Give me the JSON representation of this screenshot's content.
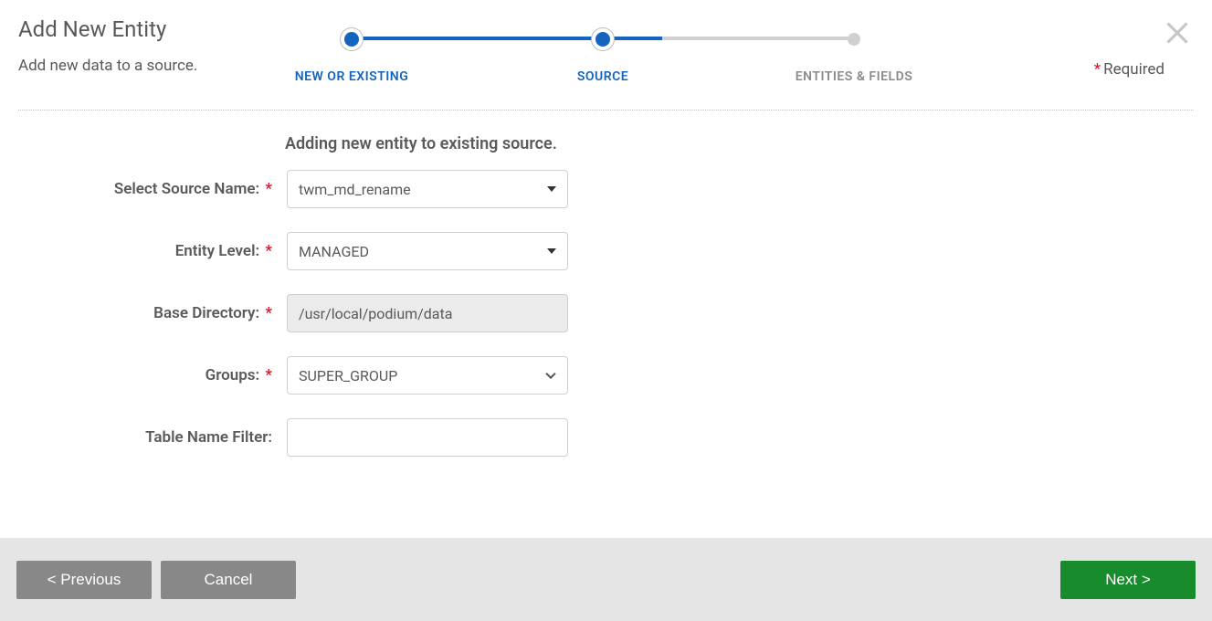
{
  "header": {
    "title": "Add New Entity",
    "subtitle": "Add new data to a source.",
    "required_label": "Required"
  },
  "stepper": {
    "steps": [
      {
        "label": "NEW OR EXISTING",
        "state": "done"
      },
      {
        "label": "SOURCE",
        "state": "current"
      },
      {
        "label": "ENTITIES & FIELDS",
        "state": "pending"
      }
    ]
  },
  "form": {
    "heading": "Adding new entity to existing source.",
    "rows": {
      "source_name": {
        "label": "Select Source Name:",
        "required": true,
        "value": "twm_md_rename"
      },
      "entity_level": {
        "label": "Entity Level:",
        "required": true,
        "value": "MANAGED"
      },
      "base_directory": {
        "label": "Base Directory:",
        "required": true,
        "value": "/usr/local/podium/data"
      },
      "groups": {
        "label": "Groups:",
        "required": true,
        "value": "SUPER_GROUP"
      },
      "table_filter": {
        "label": "Table Name Filter:",
        "required": false,
        "value": ""
      }
    }
  },
  "footer": {
    "previous": "< Previous",
    "cancel": "Cancel",
    "next": "Next >"
  }
}
